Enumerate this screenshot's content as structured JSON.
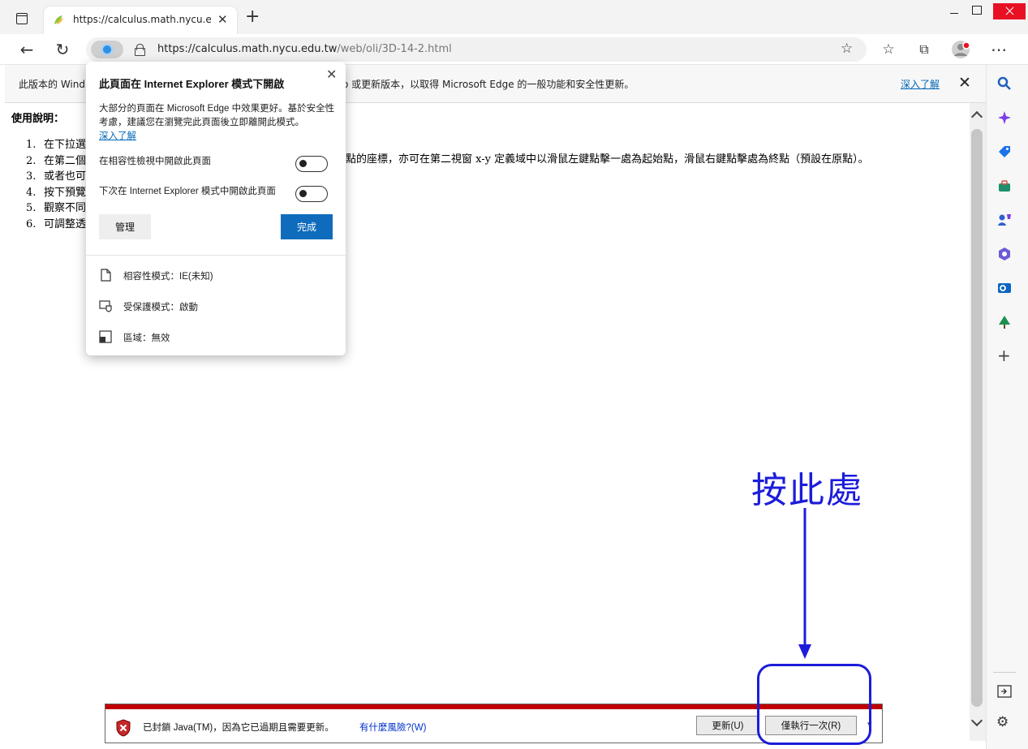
{
  "browser": {
    "tab_title": "https://calculus.math.nycu.edu.tw/",
    "url_host": "https://calculus.math.nycu.edu.tw",
    "url_path": "/web/oli/3D-14-2.html"
  },
  "infobar": {
    "text_left": "此版本的 Wind",
    "text_right": "o 或更新版本，以取得 Microsoft Edge 的一般功能和安全性更新。",
    "link": "深入了解"
  },
  "popup": {
    "title": "此頁面在 Internet Explorer 模式下開啟",
    "desc": "大部分的頁面在 Microsoft Edge 中效果更好。基於安全性考慮，建議您在瀏覽完此頁面後立即離開此模式。",
    "learn_more": "深入了解",
    "toggle1": "在相容性檢視中開啟此頁面",
    "toggle2": "下次在 Internet Explorer 模式中開啟此頁面",
    "manage": "管理",
    "done": "完成",
    "compat_mode": "相容性模式：IE(未知)",
    "protected_mode": "受保護模式：啟動",
    "zone": "區域：無效"
  },
  "page": {
    "usage_title": "使用說明：",
    "steps": [
      {
        "num": "1.",
        "text": "在下拉選"
      },
      {
        "num": "2.",
        "text": "在第二個"
      },
      {
        "num": "3.",
        "text": "或者也可"
      },
      {
        "num": "4.",
        "text": "按下預覽"
      },
      {
        "num": "5.",
        "text": "觀察不同"
      },
      {
        "num": "6.",
        "text": "可調整透"
      }
    ],
    "step2_tail": "點的座標，亦可在第二視窗 x-y 定義域中以滑鼠左鍵點擊一處為起始點，滑鼠右鍵點擊處為終點（預設在原點）。"
  },
  "javabar": {
    "message": "已封鎖 Java(TM)，因為它已過期且需要更新。",
    "risk_link": "有什麼風險?(W)",
    "update_btn": "更新(U)",
    "run_once_btn": "僅執行一次(R)"
  },
  "annotation": {
    "text": "按此處",
    "color": "#1c1cdb"
  }
}
